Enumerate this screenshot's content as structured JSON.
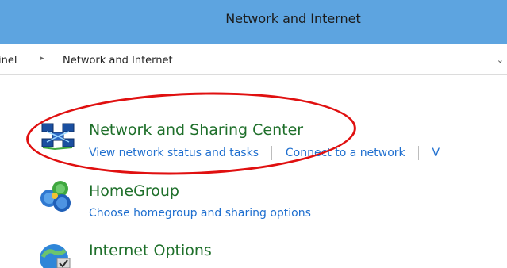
{
  "window": {
    "title": "Network and Internet"
  },
  "breadcrumb": {
    "items": [
      "inel",
      "Network and Internet"
    ],
    "separator": "▸"
  },
  "address": {
    "dropdown_glyph": "⌄"
  },
  "items": [
    {
      "title": "Network and Sharing Center",
      "icon": "network-sharing-icon",
      "links": [
        "View network status and tasks",
        "Connect to a network",
        "V"
      ]
    },
    {
      "title": "HomeGroup",
      "icon": "homegroup-icon",
      "links": [
        "Choose homegroup and sharing options"
      ]
    },
    {
      "title": "Internet Options",
      "icon": "internet-options-icon",
      "links": []
    }
  ],
  "colors": {
    "titlebar": "#5da4e0",
    "item_title": "#1e6f2a",
    "link": "#1f6fcf",
    "highlight": "#e01010"
  }
}
